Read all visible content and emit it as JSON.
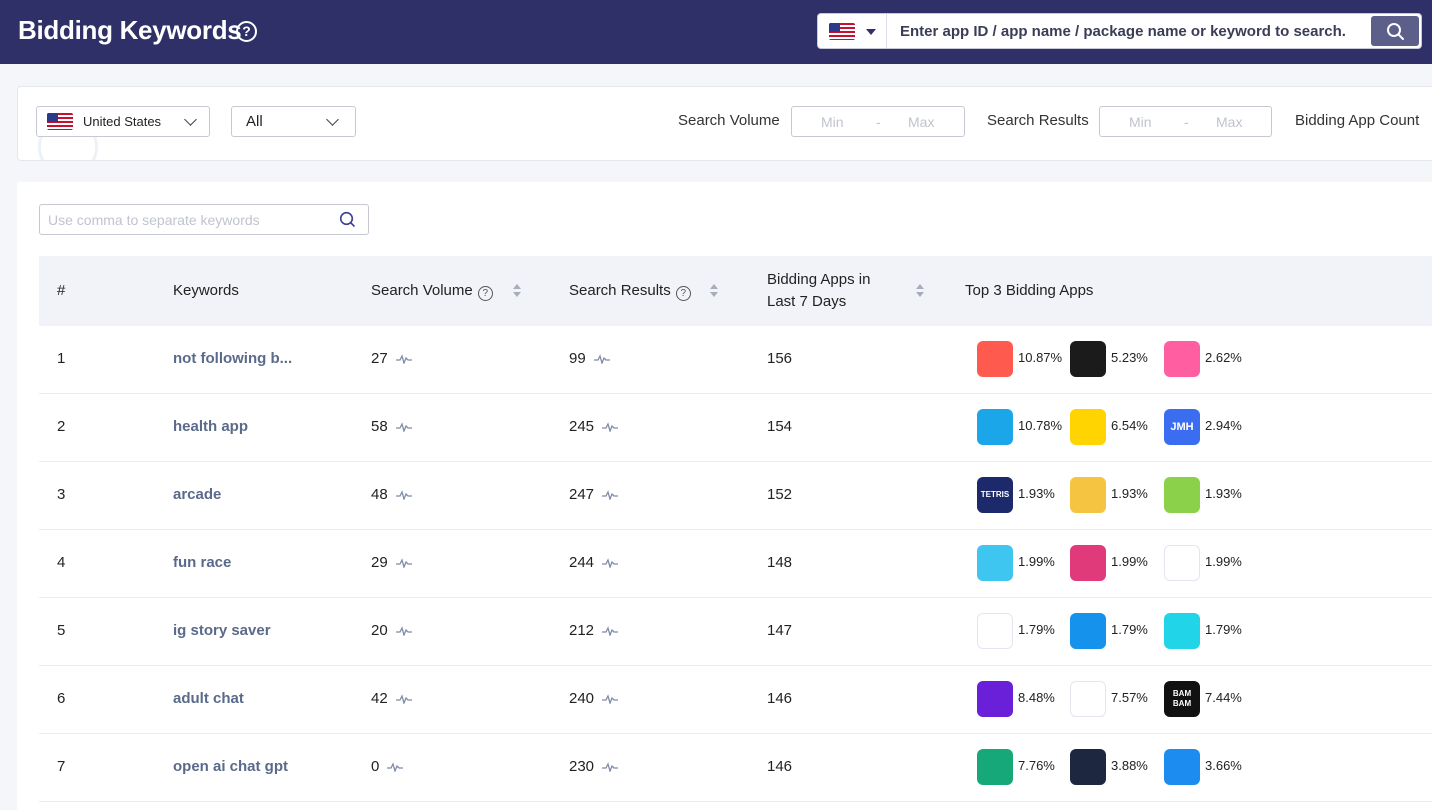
{
  "header": {
    "title": "Bidding Keywords",
    "help_glyph": "?",
    "search_placeholder": "Enter app ID / app name / package name or keyword to search."
  },
  "filters": {
    "country": "United States",
    "category": "All",
    "search_volume_label": "Search Volume",
    "search_results_label": "Search Results",
    "bidding_app_count_label": "Bidding App Count",
    "min_placeholder": "Min",
    "max_placeholder": "Max",
    "range_sep": "-"
  },
  "keyword_search": {
    "placeholder": "Use comma to separate keywords"
  },
  "table": {
    "headers": {
      "rank": "#",
      "keywords": "Keywords",
      "search_volume": "Search Volume",
      "search_results": "Search Results",
      "bidding_apps_line1": "Bidding Apps in",
      "bidding_apps_line2": "Last 7 Days",
      "top3": "Top 3 Bidding Apps"
    },
    "rows": [
      {
        "rank": "1",
        "keyword": "not following b...",
        "volume": "27",
        "results": "99",
        "bidding": "156",
        "apps": [
          {
            "pct": "10.87%",
            "icon": "user-follow-app-icon",
            "color": "#ff5a4e"
          },
          {
            "pct": "5.23%",
            "icon": "unfollowers-app-icon",
            "color": "#1b1b1b"
          },
          {
            "pct": "2.62%",
            "icon": "heart-likes-app-icon",
            "color": "#ff5fa0"
          }
        ]
      },
      {
        "rank": "2",
        "keyword": "health app",
        "volume": "58",
        "results": "245",
        "bidding": "154",
        "apps": [
          {
            "pct": "10.78%",
            "icon": "p-logo-app-icon",
            "color": "#1aa6e8"
          },
          {
            "pct": "6.54%",
            "icon": "plus-app-icon",
            "color": "#ffd400"
          },
          {
            "pct": "2.94%",
            "icon": "jmh-app-icon",
            "color": "#3b6df0",
            "text": "JMH"
          }
        ]
      },
      {
        "rank": "3",
        "keyword": "arcade",
        "volume": "48",
        "results": "247",
        "bidding": "152",
        "apps": [
          {
            "pct": "1.93%",
            "icon": "tetris-app-icon",
            "color": "#1c2a6b",
            "text": "TETRIS"
          },
          {
            "pct": "1.93%",
            "icon": "surf-game-app-icon",
            "color": "#f5c542"
          },
          {
            "pct": "1.93%",
            "icon": "dots-game-app-icon",
            "color": "#8bd14a"
          }
        ]
      },
      {
        "rank": "4",
        "keyword": "fun race",
        "volume": "29",
        "results": "244",
        "bidding": "148",
        "apps": [
          {
            "pct": "1.99%",
            "icon": "race-game-app-icon",
            "color": "#3ec6f0"
          },
          {
            "pct": "1.99%",
            "icon": "helmet-game-app-icon",
            "color": "#e13a7a"
          },
          {
            "pct": "1.99%",
            "icon": "crowd-run-app-icon",
            "color": "#ffffff"
          }
        ]
      },
      {
        "rank": "5",
        "keyword": "ig story saver",
        "volume": "20",
        "results": "212",
        "bidding": "147",
        "apps": [
          {
            "pct": "1.79%",
            "icon": "ghost-app-icon",
            "color": "#ffffff"
          },
          {
            "pct": "1.79%",
            "icon": "repost-app-icon",
            "color": "#1593ec"
          },
          {
            "pct": "1.79%",
            "icon": "circle-app-icon",
            "color": "#21d4e8"
          }
        ]
      },
      {
        "rank": "6",
        "keyword": "adult chat",
        "volume": "42",
        "results": "240",
        "bidding": "146",
        "apps": [
          {
            "pct": "8.48%",
            "icon": "star-chat-app-icon",
            "color": "#6a1fd8"
          },
          {
            "pct": "7.57%",
            "icon": "ghost-app-icon",
            "color": "#ffffff"
          },
          {
            "pct": "7.44%",
            "icon": "bambam-app-icon",
            "color": "#111111",
            "text": "BAM BAM"
          }
        ]
      },
      {
        "rank": "7",
        "keyword": "open ai chat gpt",
        "volume": "0",
        "results": "230",
        "bidding": "146",
        "apps": [
          {
            "pct": "7.76%",
            "icon": "ai-s-app-icon",
            "color": "#17a87a"
          },
          {
            "pct": "3.88%",
            "icon": "robot-app-icon",
            "color": "#1e2740"
          },
          {
            "pct": "3.66%",
            "icon": "robot-face-app-icon",
            "color": "#1c8cf0"
          }
        ]
      }
    ]
  }
}
